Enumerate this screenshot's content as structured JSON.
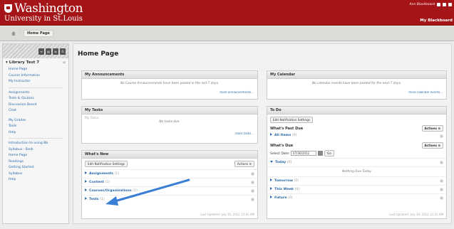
{
  "header": {
    "logo_line1": "Washington",
    "logo_line2": "University in St.Louis",
    "user_text": "Ann Blackboard",
    "tab_label": "My Blackboard"
  },
  "breadcrumb": {
    "current": "Home Page"
  },
  "sidebar": {
    "course_title": "Library Test 7",
    "tools": [
      "≡",
      "▤",
      "⇆",
      "G"
    ],
    "groups": [
      [
        "Home Page",
        "Course Information",
        "My Instructor"
      ],
      [
        "Assignments",
        "Tests & Quizzes",
        "Discussion Board",
        "Chat"
      ],
      [
        "My Grades",
        "Tools",
        "Help"
      ],
      [
        "Introduction to using Bb",
        "Syllabus - Barb",
        "Home Page",
        "Readings",
        "Getting Started",
        "Syllabus",
        "Help"
      ]
    ]
  },
  "page_title": "Home Page",
  "announcements": {
    "title": "My Announcements",
    "empty": "No Course Announcements have been posted in the last 7 days.",
    "more": "more announcements..."
  },
  "tasks": {
    "title": "My Tasks",
    "label": "My Tasks:",
    "empty": "No tasks due.",
    "more": "more tasks..."
  },
  "whatsnew": {
    "title": "What's New",
    "edit": "Edit Notification Settings",
    "actions": "Actions ≡",
    "rows": [
      {
        "label": "Assignments",
        "count": "(1)"
      },
      {
        "label": "Content",
        "count": "(1)"
      },
      {
        "label": "Courses/Organizations",
        "count": "(1)"
      },
      {
        "label": "Tests",
        "count": "(1)"
      }
    ],
    "updated": "Last Updated: July 30, 2012 12:41 AM"
  },
  "calendar": {
    "title": "My Calendar",
    "empty": "No calendar events have been posted for the next 7 days.",
    "more": "more calendar events..."
  },
  "todo": {
    "title": "To Do",
    "edit": "Edit Notification Settings",
    "past_due": "What's Past Due",
    "actions": "Actions ≡",
    "all_items": "All Items",
    "all_count": "(0)",
    "whats_due": "What's Due",
    "select_date": "Select Date:",
    "date_value": "07/30/2012",
    "go": "Go",
    "rows": [
      {
        "label": "Today",
        "count": "(0)"
      },
      {
        "label": "Tomorrow",
        "count": "(0)"
      },
      {
        "label": "This Week",
        "count": "(0)"
      },
      {
        "label": "Future",
        "count": "(0)"
      }
    ],
    "nothing": "Nothing Due Today",
    "updated": "Last Updated: July 30, 2012 12:41 AM"
  },
  "colors": {
    "header": "#a51417",
    "link": "#2a6aa8",
    "arrow": "#3a7fd5"
  }
}
